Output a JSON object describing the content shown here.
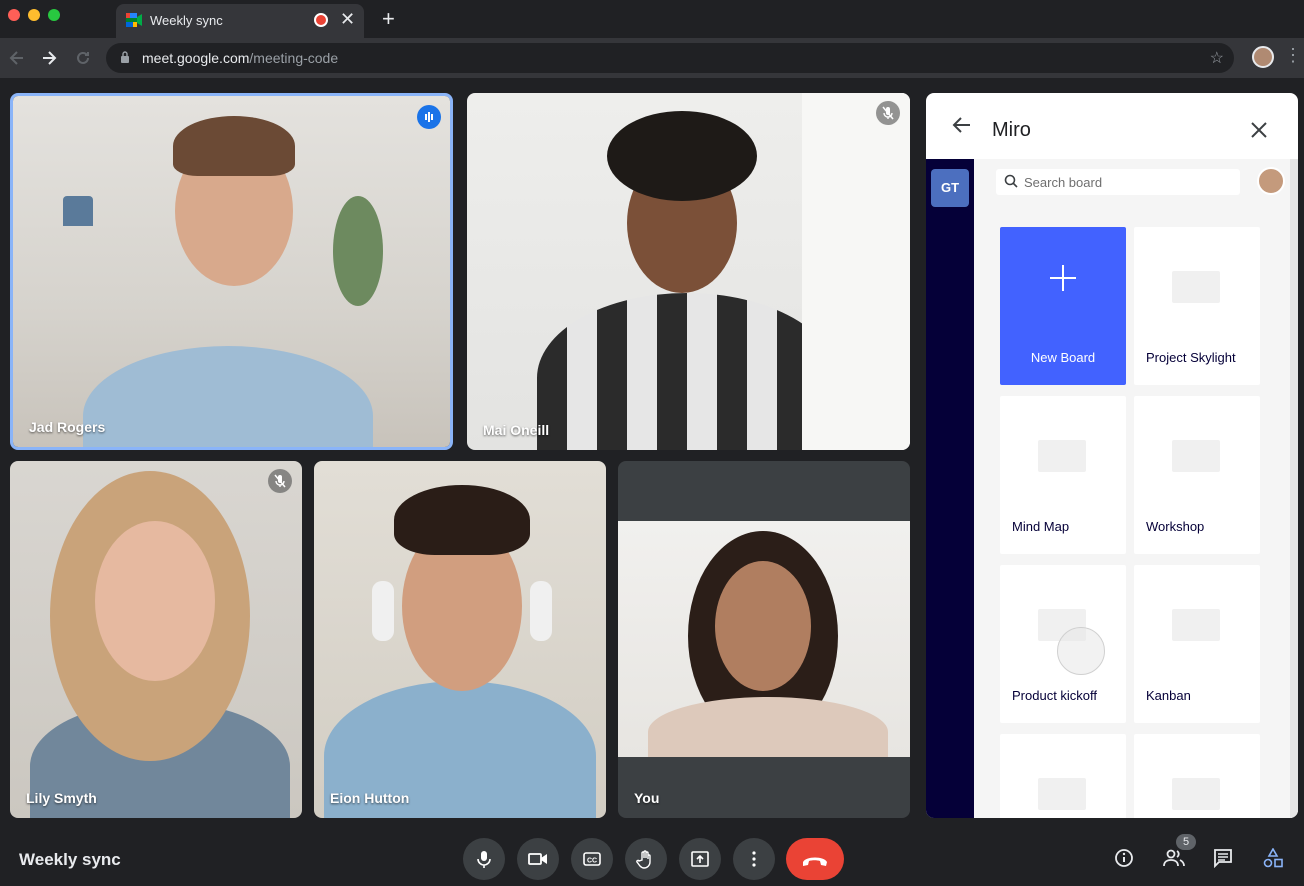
{
  "browser": {
    "tab_title": "Weekly sync",
    "url_host": "meet.google.com",
    "url_path": "/meeting-code",
    "tab_close": "✕",
    "new_tab": "+"
  },
  "participants": [
    {
      "name": "Jad Rogers",
      "status": "speaking"
    },
    {
      "name": "Mai Oneill",
      "status": "muted"
    },
    {
      "name": "Lily Smyth",
      "status": "muted"
    },
    {
      "name": "Eion Hutton",
      "status": ""
    },
    {
      "name": "You",
      "status": ""
    }
  ],
  "panel": {
    "title": "Miro",
    "workspace_initials": "GT",
    "search_placeholder": "Search board",
    "boards": [
      {
        "label": "New Board"
      },
      {
        "label": "Project Skylight"
      },
      {
        "label": "Mind Map"
      },
      {
        "label": "Workshop"
      },
      {
        "label": "Product kickoff"
      },
      {
        "label": "Kanban"
      },
      {
        "label": ""
      },
      {
        "label": ""
      }
    ]
  },
  "meeting": {
    "title": "Weekly sync",
    "participant_count": "5"
  },
  "colors": {
    "accent": "#1a73e8",
    "hangup": "#ea4335",
    "miro_blue": "#4262ff",
    "miro_rail": "#050038"
  }
}
